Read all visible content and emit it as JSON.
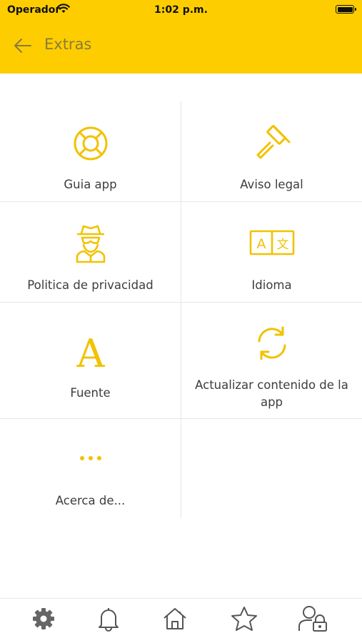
{
  "status_bar": {
    "carrier": "Operador",
    "time": "1:02 p.m."
  },
  "header": {
    "title": "Extras"
  },
  "grid": {
    "items": [
      {
        "label": "Guia app",
        "icon": "lifebuoy-icon"
      },
      {
        "label": "Aviso legal",
        "icon": "gavel-icon"
      },
      {
        "label": "Politica de privacidad",
        "icon": "spy-icon"
      },
      {
        "label": "Idioma",
        "icon": "translate-icon"
      },
      {
        "label": "Fuente",
        "icon": "font-icon"
      },
      {
        "label": "Actualizar contenido de la app",
        "icon": "refresh-icon"
      },
      {
        "label": "Acerca de...",
        "icon": "more-icon"
      }
    ]
  },
  "tabbar": {
    "tabs": [
      {
        "icon": "gear-icon",
        "active": true
      },
      {
        "icon": "bell-icon"
      },
      {
        "icon": "home-icon"
      },
      {
        "icon": "star-icon"
      },
      {
        "icon": "user-lock-icon"
      }
    ]
  },
  "colors": {
    "accent": "#fdcd00",
    "icon_yellow": "#f2c200",
    "tab_active": "#666666",
    "tab_inactive": "#555555"
  }
}
